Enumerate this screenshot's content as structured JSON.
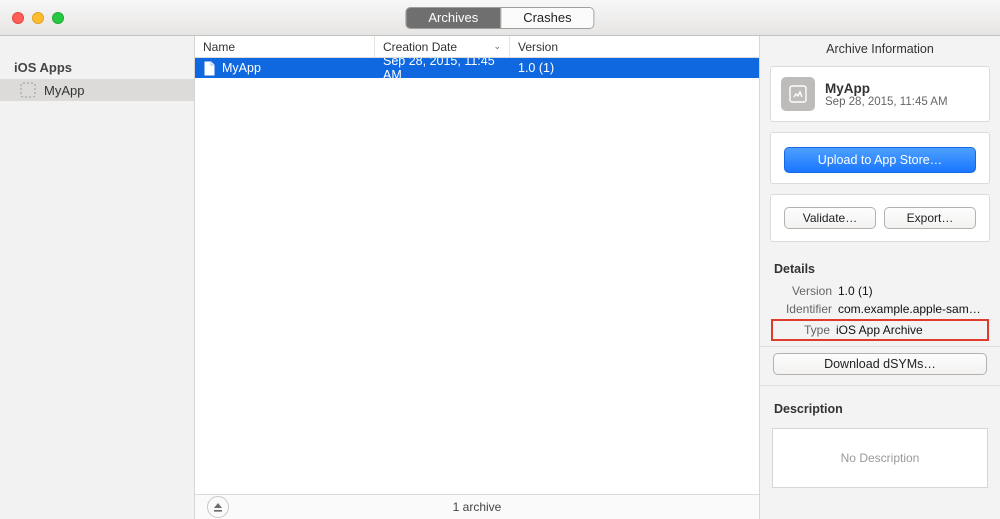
{
  "tabs": {
    "archives": "Archives",
    "crashes": "Crashes",
    "active": "archives"
  },
  "sidebar": {
    "heading": "iOS Apps",
    "items": [
      {
        "label": "MyApp",
        "selected": true
      }
    ]
  },
  "columns": {
    "name": "Name",
    "creation_date": "Creation Date",
    "version": "Version"
  },
  "rows": [
    {
      "name": "MyApp",
      "date": "Sep 28, 2015, 11:45 AM",
      "version": "1.0 (1)",
      "selected": true
    }
  ],
  "status": {
    "count": "1 archive"
  },
  "inspector": {
    "title": "Archive Information",
    "app_name": "MyApp",
    "app_date": "Sep 28, 2015, 11:45 AM",
    "upload_label": "Upload to App Store…",
    "validate_label": "Validate…",
    "export_label": "Export…",
    "details_heading": "Details",
    "details": {
      "version_k": "Version",
      "version_v": "1.0 (1)",
      "identifier_k": "Identifier",
      "identifier_v": "com.example.apple-sam…",
      "type_k": "Type",
      "type_v": "iOS App Archive"
    },
    "dsym_label": "Download dSYMs…",
    "description_heading": "Description",
    "description_placeholder": "No Description"
  }
}
